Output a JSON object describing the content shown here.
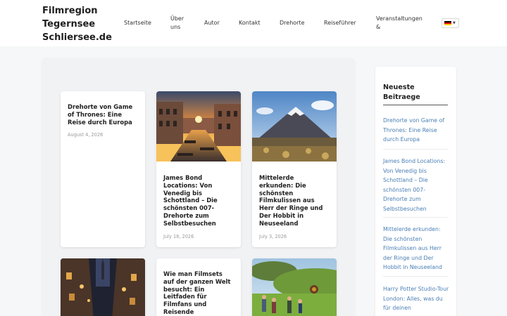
{
  "header": {
    "site_title": "Filmregion Tegernsee Schliersee.de",
    "nav": [
      {
        "label": "Startseite"
      },
      {
        "label": "Über uns"
      },
      {
        "label": "Autor"
      },
      {
        "label": "Kontakt"
      },
      {
        "label": "Drehorte"
      },
      {
        "label": "Reiseführer"
      },
      {
        "label": "Veranstaltungen &"
      }
    ],
    "language_flag": "de-flag-icon"
  },
  "posts": [
    {
      "title": "Drehorte von Game of Thrones: Eine Reise durch Europa",
      "date": "August 4, 2026",
      "image": "none"
    },
    {
      "title": "James Bond Locations: Von Venedig bis Schottland – Die schönsten 007-Drehorte zum Selbstbesuchen",
      "date": "July 18, 2026",
      "image": "venice-canal-sunset"
    },
    {
      "title": "Mittelerde erkunden: Die schönsten Filmkulissen aus Herr der Ringe und Der Hobbit in Neuseeland",
      "date": "July 3, 2026",
      "image": "volcano-landscape"
    },
    {
      "title": "",
      "date": "",
      "image": "old-town-alley-night"
    },
    {
      "title": "Wie man Filmsets auf der ganzen Welt besucht: Ein Leitfaden für Filmfans und Reisende",
      "date": "",
      "image": "none"
    },
    {
      "title": "",
      "date": "",
      "image": "hobbit-hill-tourists"
    }
  ],
  "sidebar": {
    "heading": "Neueste Beitraege",
    "links": [
      {
        "label": "Drehorte von Game of Thrones: Eine Reise durch Europa"
      },
      {
        "label": "James Bond Locations: Von Venedig bis Schottland – Die schönsten 007-Drehorte zum Selbstbesuchen"
      },
      {
        "label": "Mittelerde erkunden: Die schönsten Filmkulissen aus Herr der Ringe und Der Hobbit in Neuseeland"
      },
      {
        "label": "Harry Potter Studio-Tour London: Alles, was du für deinen"
      }
    ]
  },
  "colors": {
    "link": "#4a7fb5",
    "date": "#9a9a9a",
    "background": "#f6f7f8"
  }
}
